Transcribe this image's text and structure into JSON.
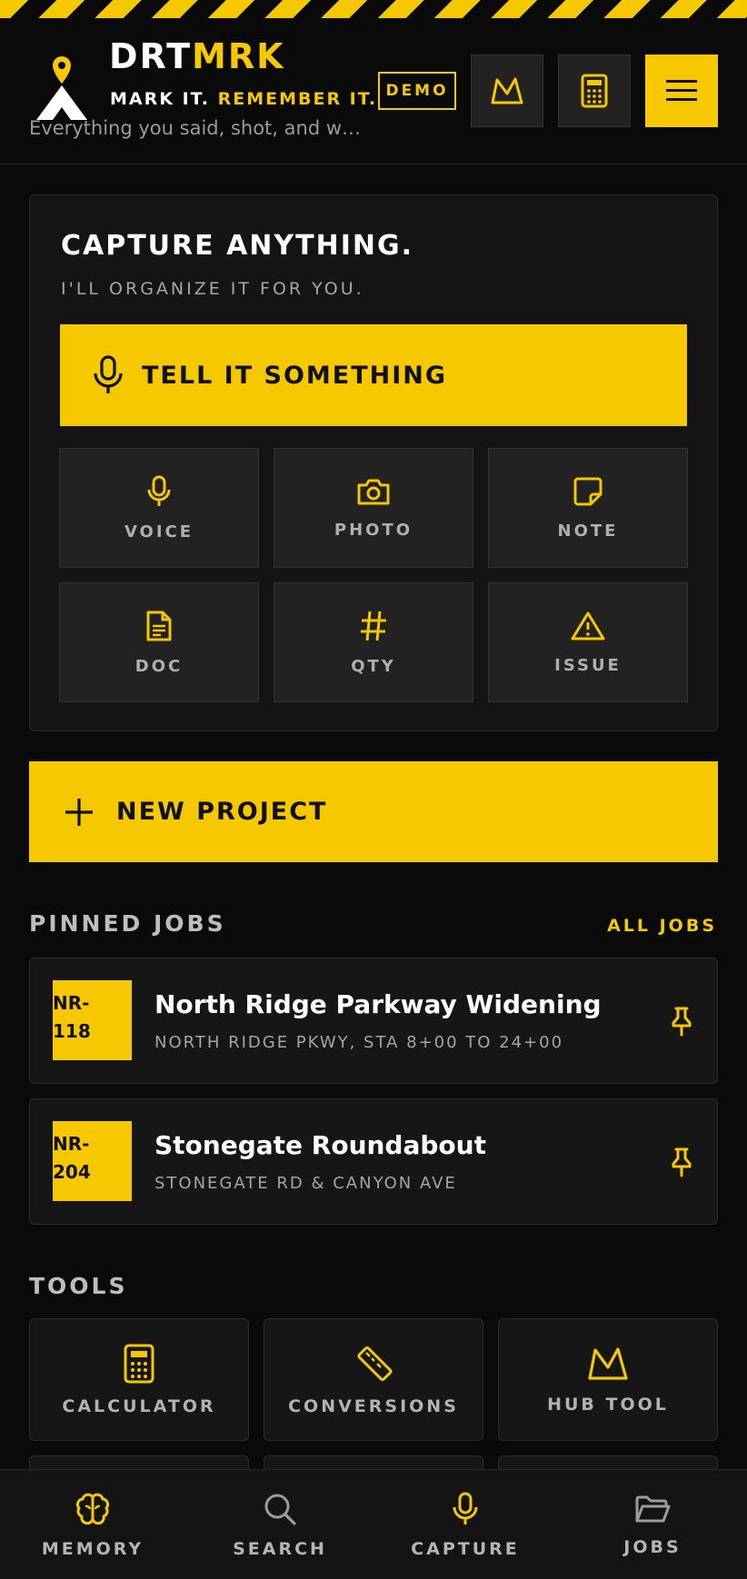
{
  "header": {
    "brand_primary": "DRT",
    "brand_accent": "MRK",
    "tagline_primary": "MARK IT.",
    "tagline_accent": "REMEMBER IT.",
    "subtitle": "Everything you said, shot, and wr...",
    "demo_badge": "DEMO"
  },
  "capture": {
    "title": "CAPTURE ANYTHING.",
    "subtitle": "I'LL ORGANIZE IT FOR YOU.",
    "primary_action": "TELL IT SOMETHING",
    "tiles": [
      {
        "label": "VOICE",
        "icon": "mic-icon"
      },
      {
        "label": "PHOTO",
        "icon": "camera-icon"
      },
      {
        "label": "NOTE",
        "icon": "note-icon"
      },
      {
        "label": "DOC",
        "icon": "document-icon"
      },
      {
        "label": "QTY",
        "icon": "hash-icon"
      },
      {
        "label": "ISSUE",
        "icon": "warning-icon"
      }
    ]
  },
  "new_project": "NEW PROJECT",
  "pinned": {
    "title": "PINNED JOBS",
    "all_link": "ALL JOBS",
    "jobs": [
      {
        "id_line1": "NR-",
        "id_line2": "118",
        "name": "North Ridge Parkway Widening",
        "location": "NORTH RIDGE PKWY, STA 8+00 TO 24+00"
      },
      {
        "id_line1": "NR-",
        "id_line2": "204",
        "name": "Stonegate Roundabout",
        "location": "STONEGATE RD & CANYON AVE"
      }
    ]
  },
  "tools": {
    "title": "TOOLS",
    "items": [
      {
        "label": "CALCULATOR",
        "icon": "calculator-icon"
      },
      {
        "label": "CONVERSIONS",
        "icon": "ruler-icon"
      },
      {
        "label": "HUB TOOL",
        "icon": "hub-icon"
      }
    ]
  },
  "nav": [
    {
      "label": "MEMORY",
      "icon": "brain-icon"
    },
    {
      "label": "SEARCH",
      "icon": "search-icon"
    },
    {
      "label": "CAPTURE",
      "icon": "mic-icon"
    },
    {
      "label": "JOBS",
      "icon": "folder-icon"
    }
  ],
  "colors": {
    "accent": "#f5c800",
    "background": "#0a0a0a",
    "card": "#161616"
  }
}
